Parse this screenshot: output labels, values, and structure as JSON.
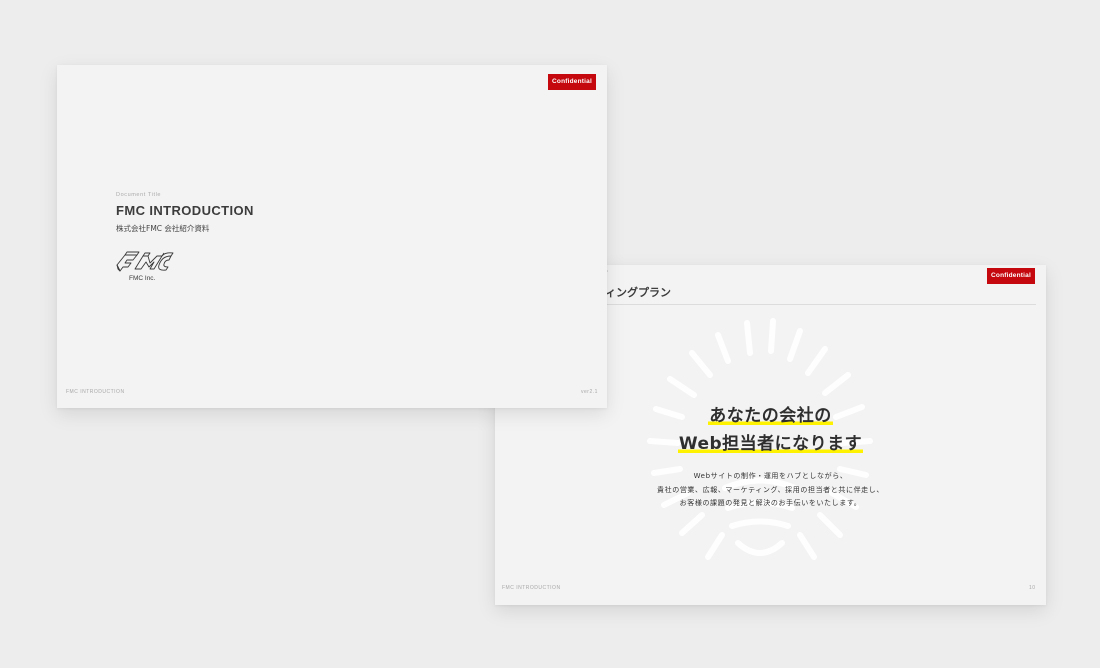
{
  "slide1": {
    "badge": "Confidential",
    "doc_label": "Document Title",
    "title": "FMC INTRODUCTION",
    "subtitle": "株式会社FMC 会社紹介資料",
    "logo_text": "FMC Inc.",
    "footer_left": "FMC INTRODUCTION",
    "footer_right": "ver2.1"
  },
  "slide2": {
    "badge": "Confidential",
    "section_label": "グ",
    "title": "ィングプラン",
    "headline_line1": "あなたの会社の",
    "headline_line2": "Web担当者になります",
    "body_lines": [
      "Webサイトの制作・運用をハブとしながら、",
      "貴社の営業、広報、マーケティング、採用の担当者と共に伴走し、",
      "お客様の課題の発見と解決のお手伝いをいたします。"
    ],
    "footer_left": "FMC INTRODUCTION",
    "footer_right": "10"
  },
  "colors": {
    "accent_red": "#c4080e",
    "highlight_yellow": "#fff200",
    "background": "#ededed",
    "slide": "#f3f3f3"
  }
}
